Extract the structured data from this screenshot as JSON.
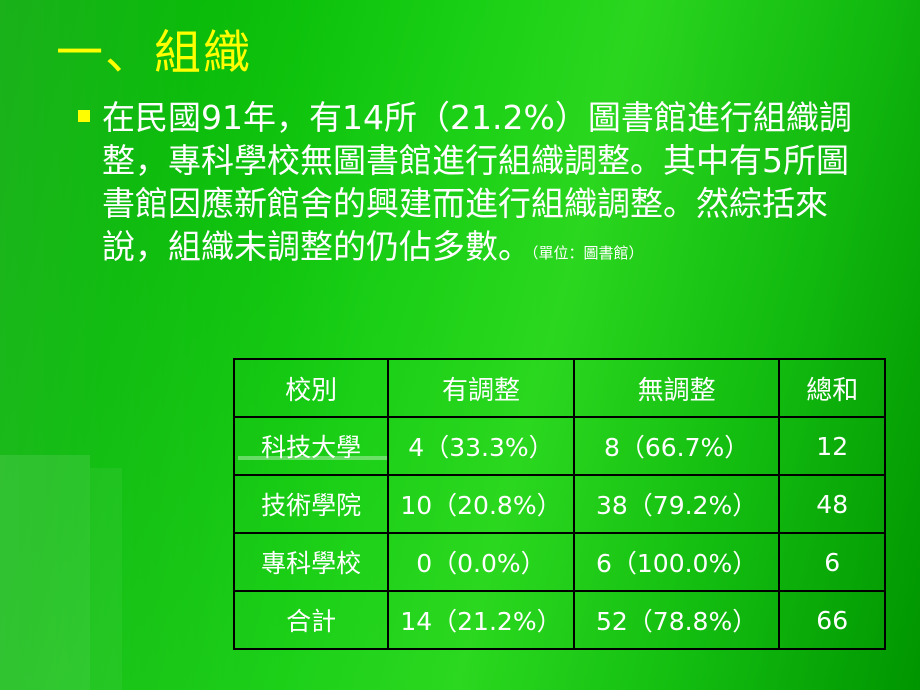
{
  "slide": {
    "title": "一、組織",
    "bullet": {
      "text": "在民國91年，有14所（21.2%）圖書館進行組織調整，專科學校無圖書館進行組織調整。其中有5所圖書館因應新館舍的興建而進行組織調整。然綜括來說，組織未調整的仍佔多數。",
      "unit_note": "（單位：圖書館）"
    },
    "table": {
      "headers": [
        "校別",
        "有調整",
        "無調整",
        "總和"
      ],
      "rows": [
        [
          "科技大學",
          "4（33.3%）",
          "8（66.7%）",
          "12"
        ],
        [
          "技術學院",
          "10（20.8%）",
          "38（79.2%）",
          "48"
        ],
        [
          "專科學校",
          "0（0.0%）",
          "6（100.0%）",
          "6"
        ],
        [
          "合計",
          "14（21.2%）",
          "52（78.8%）",
          "66"
        ]
      ]
    },
    "colors": {
      "background_start": "#00a800",
      "background_mid": "#2bd81f",
      "title_color": "#ffff00",
      "text_color": "#ffffff",
      "table_border": "#000000"
    }
  }
}
